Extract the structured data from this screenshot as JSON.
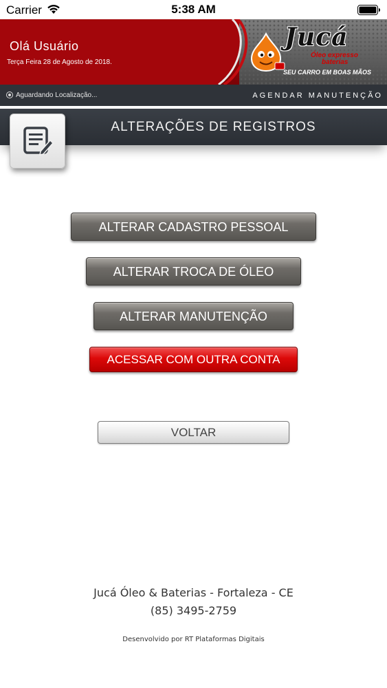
{
  "status_bar": {
    "carrier": "Carrier",
    "time": "5:38 AM",
    "icons": [
      "wifi-icon",
      "battery-icon"
    ]
  },
  "header": {
    "greeting": "Olá Usuário",
    "date": "Terça Feira 28 de Agosto de 2018.",
    "logo": {
      "brand": "Jucá",
      "line1": "Óleo expresso",
      "line2": "baterias",
      "tagline": "SEU CARRO EM BOAS MÃOS"
    },
    "colors": {
      "primary": "#a0050a",
      "metal": "#5a5a5a"
    }
  },
  "location_bar": {
    "status": "Aguardando Localização...",
    "schedule_label": "AGENDAR MANUTENÇÃO"
  },
  "page": {
    "title": "ALTERAÇÕES DE REGISTROS",
    "title_icon": "edit-document-icon"
  },
  "actions": {
    "edit_profile": "ALTERAR CADASTRO PESSOAL",
    "edit_oil_change": "ALTERAR TROCA DE ÓLEO",
    "edit_maintenance": "ALTERAR MANUTENÇÃO",
    "other_account": "ACESSAR COM OUTRA CONTA",
    "back": "VOLTAR"
  },
  "footer": {
    "company": "Jucá Óleo & Baterias - Fortaleza - CE",
    "phone": "(85) 3495-2759",
    "developer": "Desenvolvido por RT Plataformas Digitais"
  }
}
